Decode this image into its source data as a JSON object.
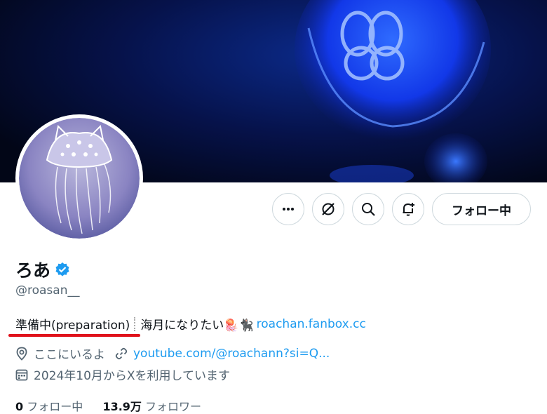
{
  "profile": {
    "display_name": "ろあ",
    "handle": "@roasan__",
    "verified_icon": "verified-badge-icon",
    "bio_status": "準備中(preparation)",
    "bio_text": "海月になりたい🪼🐈‍⬛",
    "bio_link": "roachan.fanbox.cc",
    "location": "ここにいるよ",
    "website": "youtube.com/@roachann?si=Q...",
    "joined": "2024年10月からXを利用しています"
  },
  "actions": {
    "more_icon": "more-icon",
    "grok_icon": "grok-icon",
    "search_icon": "search-icon",
    "notify_icon": "bell-plus-icon",
    "follow_label": "フォロー中"
  },
  "stats": {
    "following_count": "0",
    "following_label": "フォロー中",
    "followers_count": "13.9万",
    "followers_label": "フォロワー"
  },
  "colors": {
    "accent": "#1d9bf0",
    "highlight_underline": "#e0121b",
    "banner": "#0b2a8a"
  }
}
